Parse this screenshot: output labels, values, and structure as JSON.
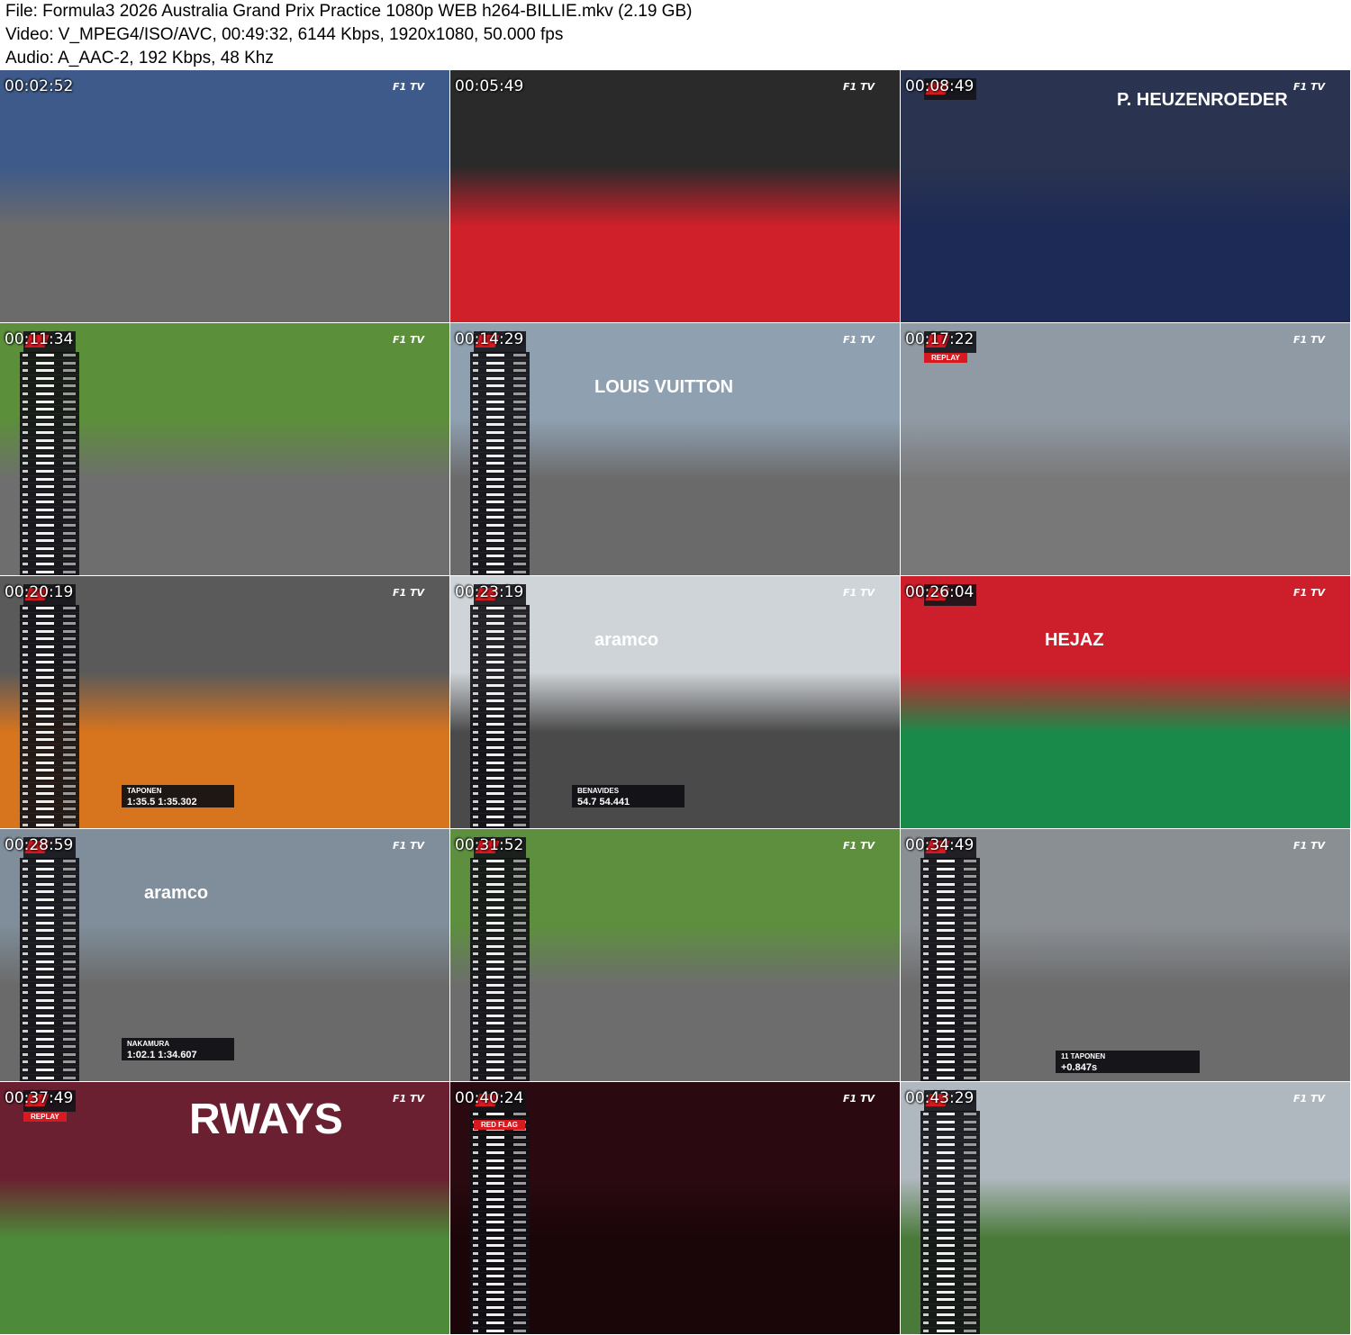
{
  "header": {
    "file_line": "File: Formula3 2026 Australia Grand Prix Practice 1080p WEB h264-BILLIE.mkv (2.19 GB)",
    "video_line": "Video: V_MPEG4/ISO/AVC, 00:49:32, 6144 Kbps, 1920x1080, 50.000 fps",
    "audio_line": "Audio: A_AAC-2, 192 Kbps, 48 Khz"
  },
  "broadcaster": "F1 TV",
  "thumbnails": [
    {
      "timestamp": "00:02:52",
      "scene": "grandstand-straight",
      "bg_top": "#3d5a8a",
      "bg_bottom": "#6b6b6b"
    },
    {
      "timestamp": "00:05:49",
      "scene": "helmet-closeup",
      "bg_top": "#2a2a2a",
      "bg_bottom": "#d0202a"
    },
    {
      "timestamp": "00:08:49",
      "scene": "cockpit-heuzenroeder",
      "bg_top": "#2a3350",
      "bg_bottom": "#1c2a55",
      "overlay_text": "P. HEUZENROEDER"
    },
    {
      "timestamp": "00:11:34",
      "scene": "green-verge-corner",
      "bg_top": "#5c8f3a",
      "bg_bottom": "#6e6e6e"
    },
    {
      "timestamp": "00:14:29",
      "scene": "louis-vuitton-straight",
      "bg_top": "#8fa0b0",
      "bg_bottom": "#6a6a6a",
      "overlay_text": "LOUIS VUITTON"
    },
    {
      "timestamp": "00:17:22",
      "scene": "replay-green-car",
      "bg_top": "#909aa4",
      "bg_bottom": "#787878",
      "replay_label": "REPLAY"
    },
    {
      "timestamp": "00:20:19",
      "scene": "onboard-orange",
      "bg_top": "#5a5a5a",
      "bg_bottom": "#d7741e",
      "driver_name": "TAPONEN",
      "lap_time": "1:35.5",
      "best_time": "1:35.302"
    },
    {
      "timestamp": "00:23:19",
      "scene": "gravel-trap",
      "bg_top": "#cfd4d8",
      "bg_bottom": "#4a4a4a",
      "driver_name": "BENAVIDES",
      "lap_time": "54.7",
      "best_time": "54.441",
      "overlay_text": "aramco"
    },
    {
      "timestamp": "00:26:04",
      "scene": "hejaz-garage",
      "bg_top": "#cc1f2b",
      "bg_bottom": "#1a8a4a",
      "overlay_text": "HEJAZ"
    },
    {
      "timestamp": "00:28:59",
      "scene": "aramco-bridge",
      "bg_top": "#7f8e9a",
      "bg_bottom": "#6a6a6a",
      "driver_name": "NAKAMURA",
      "lap_time": "1:02.1",
      "best_time": "1:34.607",
      "overlay_text": "aramco"
    },
    {
      "timestamp": "00:31:52",
      "scene": "white-red-car-msc",
      "bg_top": "#5d8f3e",
      "bg_bottom": "#6d6d6d"
    },
    {
      "timestamp": "00:34:49",
      "scene": "two-cars-straight",
      "bg_top": "#8a8f94",
      "bg_bottom": "#6c6c6c",
      "driver_name": "TAPONEN",
      "gap": "+0.847s",
      "position": "11"
    },
    {
      "timestamp": "00:37:49",
      "scene": "gravel-spin-replay",
      "bg_top": "#6a2030",
      "bg_bottom": "#4d8a3a",
      "replay_label": "REPLAY",
      "overlay_text": "RWAYS"
    },
    {
      "timestamp": "00:40:24",
      "scene": "red-flag-f3-logo",
      "bg_top": "#2a0a10",
      "bg_bottom": "#1a0508",
      "flag_label": "RED FLAG"
    },
    {
      "timestamp": "00:43:29",
      "scene": "aerial-melbourne",
      "bg_top": "#b0b8bf",
      "bg_bottom": "#4a7a3a"
    }
  ]
}
